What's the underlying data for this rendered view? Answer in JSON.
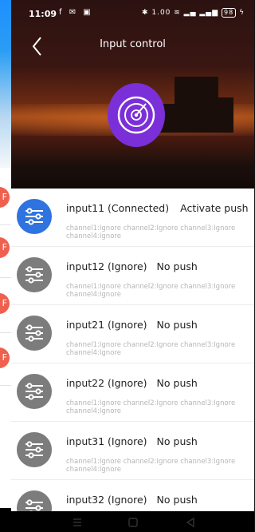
{
  "status": {
    "time": "11:09",
    "left_icons": "f ✉ ▣",
    "right_icons": "✱ 1.00 ≋ ▂▄ ▂▄▆",
    "battery": "98"
  },
  "header": {
    "title": "Input control"
  },
  "peek": {
    "pill": "F"
  },
  "inputs": [
    {
      "name": "input11 (Connected)",
      "push": "Activate push",
      "channels": "channel1:Ignore  channel2:Ignore  channel3:Ignore  channel4:Ignore",
      "active": true
    },
    {
      "name": "input12 (Ignore)",
      "push": "No push",
      "channels": "channel1:Ignore  channel2:Ignore  channel3:Ignore  channel4:Ignore",
      "active": false
    },
    {
      "name": "input21 (Ignore)",
      "push": "No push",
      "channels": "channel1:Ignore  channel2:Ignore  channel3:Ignore  channel4:Ignore",
      "active": false
    },
    {
      "name": "input22 (Ignore)",
      "push": "No push",
      "channels": "channel1:Ignore  channel2:Ignore  channel3:Ignore  channel4:Ignore",
      "active": false
    },
    {
      "name": "input31 (Ignore)",
      "push": "No push",
      "channels": "channel1:Ignore  channel2:Ignore  channel3:Ignore  channel4:Ignore",
      "active": false
    },
    {
      "name": "input32 (Ignore)",
      "push": "No push",
      "channels": "",
      "active": false
    }
  ],
  "colors": {
    "accent_blue": "#2f73e0",
    "icon_grey": "#7c7c7c",
    "radar_purple": "#7b2fd8",
    "pill_red": "#f0604f"
  }
}
